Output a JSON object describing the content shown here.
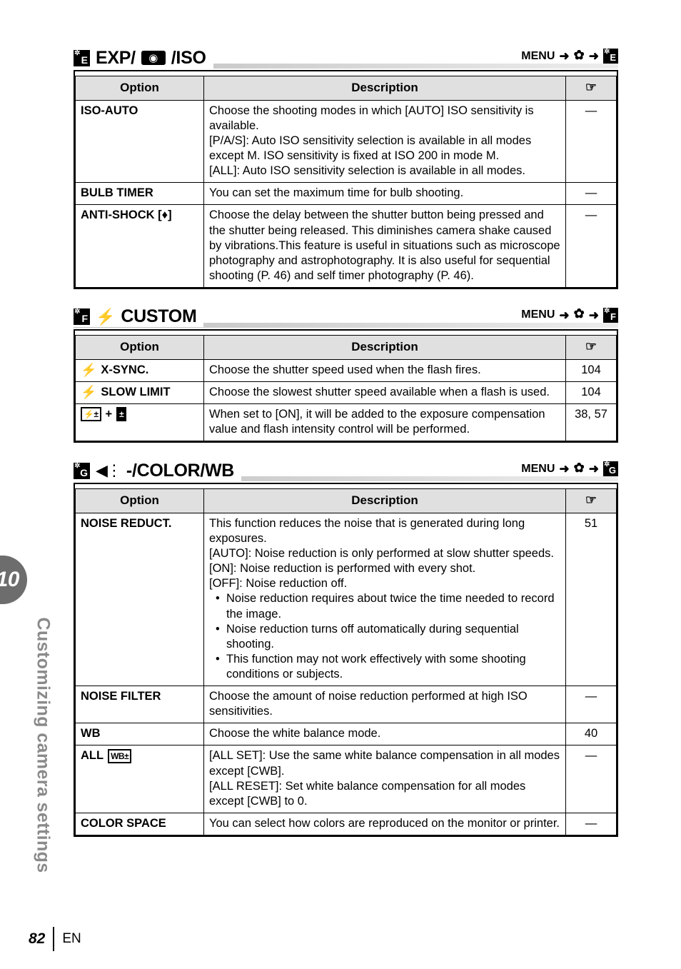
{
  "chapter": {
    "number": "10",
    "title": "Customizing camera settings"
  },
  "footer": {
    "page_number": "82",
    "language": "EN"
  },
  "menu_label": "MENU",
  "arrow_glyph": "➜",
  "gear_glyph": "✿",
  "hand_glyph": "☞",
  "table_headers": {
    "option": "Option",
    "description": "Description",
    "reference": "☞"
  },
  "sections": [
    {
      "id": "exp-iso",
      "tab_letter": "E",
      "title_before": "EXP/",
      "metering_glyph": "◉",
      "title_after": "/ISO",
      "menu_tab_letter": "E",
      "rows": [
        {
          "option": "ISO-AUTO",
          "lines": [
            "Choose the shooting modes in which [AUTO] ISO sensitivity is available.",
            "[P/A/S]: Auto ISO sensitivity selection is available in all modes except M. ISO sensitivity is fixed at ISO 200 in mode M.",
            "[ALL]: Auto ISO sensitivity selection is available in all modes."
          ],
          "ref": "—"
        },
        {
          "option": "BULB TIMER",
          "lines": [
            "You can set the maximum time for bulb shooting."
          ],
          "ref": "—"
        },
        {
          "option": "ANTI-SHOCK [♦]",
          "lines": [
            "Choose the delay between the shutter button being pressed and the shutter being released. This diminishes camera shake caused by vibrations.This feature is useful in situations such as microscope photography and astrophotography. It is also useful for sequential shooting (P. 46) and self timer photography (P. 46)."
          ],
          "ref": "—"
        }
      ]
    },
    {
      "id": "flash-custom",
      "tab_letter": "F",
      "flash_glyph": "⚡",
      "title": "CUSTOM",
      "menu_tab_letter": "F",
      "rows": [
        {
          "option": "X-SYNC.",
          "option_icon": "flash",
          "lines": [
            "Choose the shutter speed used when the flash fires."
          ],
          "ref": "104"
        },
        {
          "option": "SLOW LIMIT",
          "option_icon": "flash",
          "lines": [
            "Choose the slowest shutter speed available when a flash is used."
          ],
          "ref": "104"
        },
        {
          "option": "",
          "option_icon": "flash-exp-comp",
          "icon_flash_comp": "⚡±",
          "icon_plus": "+",
          "icon_exp_comp": "±",
          "lines": [
            "When set to [ON], it will be added to the exposure compensation value and flash intensity control will be performed."
          ],
          "ref": "38, 57"
        }
      ]
    },
    {
      "id": "color-wb",
      "tab_letter": "G",
      "quality_glyph": "◀",
      "title": "-/COLOR/WB",
      "menu_tab_letter": "G",
      "rows": [
        {
          "option": "NOISE REDUCT.",
          "lines": [
            "This function reduces the noise that is generated during long exposures.",
            "[AUTO]: Noise reduction is only performed at slow shutter speeds.",
            "[ON]: Noise reduction is performed with every shot.",
            "[OFF]: Noise reduction off."
          ],
          "bullets": [
            "Noise reduction requires about twice the time needed to record the image.",
            "Noise reduction turns off automatically during sequential shooting.",
            "This function may not work effectively with some shooting conditions or subjects."
          ],
          "ref": "51"
        },
        {
          "option": "NOISE FILTER",
          "lines": [
            "Choose the amount of noise reduction performed at high ISO sensitivities."
          ],
          "ref": "—"
        },
        {
          "option": "WB",
          "lines": [
            "Choose the white balance mode."
          ],
          "ref": "40"
        },
        {
          "option": "ALL",
          "option_icon": "wb-comp",
          "icon_wb": "WB±",
          "lines": [
            "[ALL SET]: Use the same white balance compensation in all modes except [CWB].",
            "[ALL RESET]: Set white balance compensation for all modes except [CWB] to 0."
          ],
          "ref": "—"
        },
        {
          "option": "COLOR SPACE",
          "lines": [
            "You can select how colors are reproduced on the monitor or printer."
          ],
          "ref": "—"
        }
      ]
    }
  ]
}
